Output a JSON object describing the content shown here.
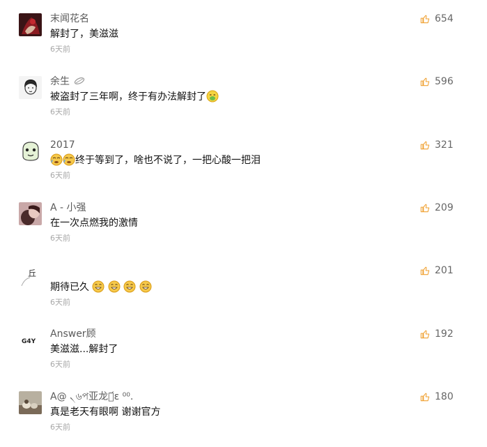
{
  "comments": [
    {
      "username": "末闻花名",
      "text": "解封了，美滋滋",
      "time": "6天前",
      "likes": "654"
    },
    {
      "username": "余生",
      "text": "被盗封了三年啊，终于有办法解封了",
      "time": "6天前",
      "likes": "596"
    },
    {
      "username": "2017",
      "text": "终于等到了，啥也不说了，一把心酸一把泪",
      "time": "6天前",
      "likes": "321"
    },
    {
      "username": "A - 小强",
      "text": "在一次点燃我的激情",
      "time": "6天前",
      "likes": "209"
    },
    {
      "username": "",
      "text": "期待已久",
      "time": "6天前",
      "likes": "201"
    },
    {
      "username": "Answer顾",
      "text": "美滋滋...解封了",
      "time": "6天前",
      "likes": "192"
    },
    {
      "username": "A@ ৲৬প亚龙呦᷄ɛ ⁰⁰.",
      "text": "真是老天有眼啊  谢谢官方",
      "time": "6天前",
      "likes": "180"
    }
  ],
  "avatar_marks": {
    "c4": "丘",
    "c5": "G4Y"
  },
  "colors": {
    "username": "#5a5a5a",
    "text": "#111111",
    "time": "#a8a8a8",
    "like_icon": "#f0a030"
  },
  "icons": {
    "like": "thumbs-up-icon",
    "badge": "feather-badge-icon",
    "emoji": "smiley-emoji-icon"
  }
}
